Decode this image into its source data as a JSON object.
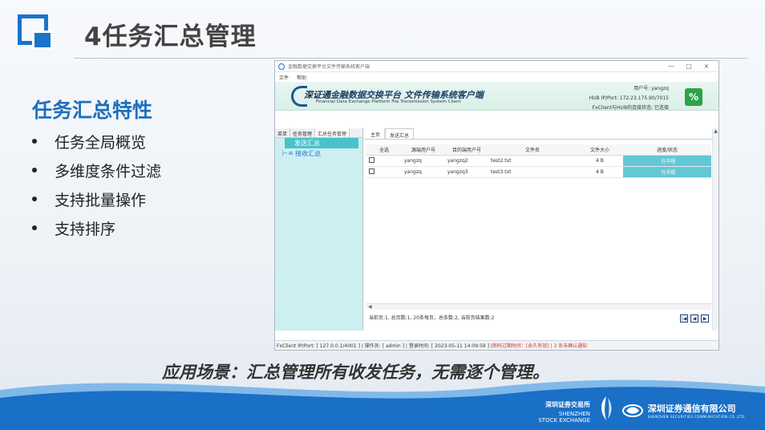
{
  "slide": {
    "title": "4任务汇总管理",
    "feature_heading": "任务汇总特性",
    "bullets": [
      "任务全局概览",
      "多维度条件过滤",
      "支持批量操作",
      "支持排序"
    ],
    "scenario": "应用场景：汇总管理所有收发任务，无需逐个管理。"
  },
  "window": {
    "title": "金融数据交换平台文件传输系统客户端",
    "controls": [
      "—",
      "□",
      "×"
    ],
    "menu": [
      "文件",
      "帮助"
    ],
    "banner": {
      "brand": "深证通",
      "title_rest": "金融数据交换平台  文件传输系统客户端",
      "subtitle": "Financial Data Exchange Platform File Transmission System Client",
      "user": "用户号: yangzq",
      "hub": "HUB IP/Port: 172.23.175.90/7015",
      "conn": "FxClient与HUB的连接状态: 已连接",
      "badge_glyph": "%"
    },
    "left_tabs": [
      "菜单",
      "任务管理",
      "汇总任务管理"
    ],
    "left_active_tab": 2,
    "tree": [
      {
        "label": "发送汇总",
        "selected": true
      },
      {
        "label": "接收汇总",
        "selected": false
      }
    ],
    "right_tabs": [
      "主页",
      "发送汇总"
    ],
    "grid": {
      "columns": [
        "全选",
        "源端用户号",
        "目的端用户号",
        "文件名",
        "文件大小",
        "进度/状态"
      ],
      "rows": [
        {
          "src": "yangzq",
          "dst": "yangzq2",
          "file": "test2.txt",
          "size": "4 B",
          "status": "在中枢"
        },
        {
          "src": "yangzq",
          "dst": "yangzq3",
          "file": "test3.txt",
          "size": "4 B",
          "status": "在中枢"
        }
      ]
    },
    "pager": "当前页:1, 总页数:1, 20条每页，总条数:2, 当前页结果数:2",
    "pager_buttons": [
      "|◀",
      "◀",
      "▶"
    ],
    "status_bar": {
      "normal": "FxClient IP/Port: [ 127.0.0.1/4001 ] | 操作员: [ admin ] | 登录时间: [ 2023-05-11 14:09:59 ] | ",
      "warn": "密码过期时间：[永久有效] | 3 条未确认通知"
    }
  },
  "footer": {
    "szse_cn": "深圳证券交易所",
    "szse_en1": "SHENZHEN",
    "szse_en2": "STOCK EXCHANGE",
    "sscc_cn": "深圳证券通信有限公司",
    "sscc_en": "SHENZHEN SECURITIES COMMUNICATION CO.,LTD."
  },
  "colors": {
    "brand_blue": "#1a74c9",
    "status_cell": "#62c8d6",
    "tree_bg": "#cdeff0",
    "warn_red": "#e0302a"
  }
}
